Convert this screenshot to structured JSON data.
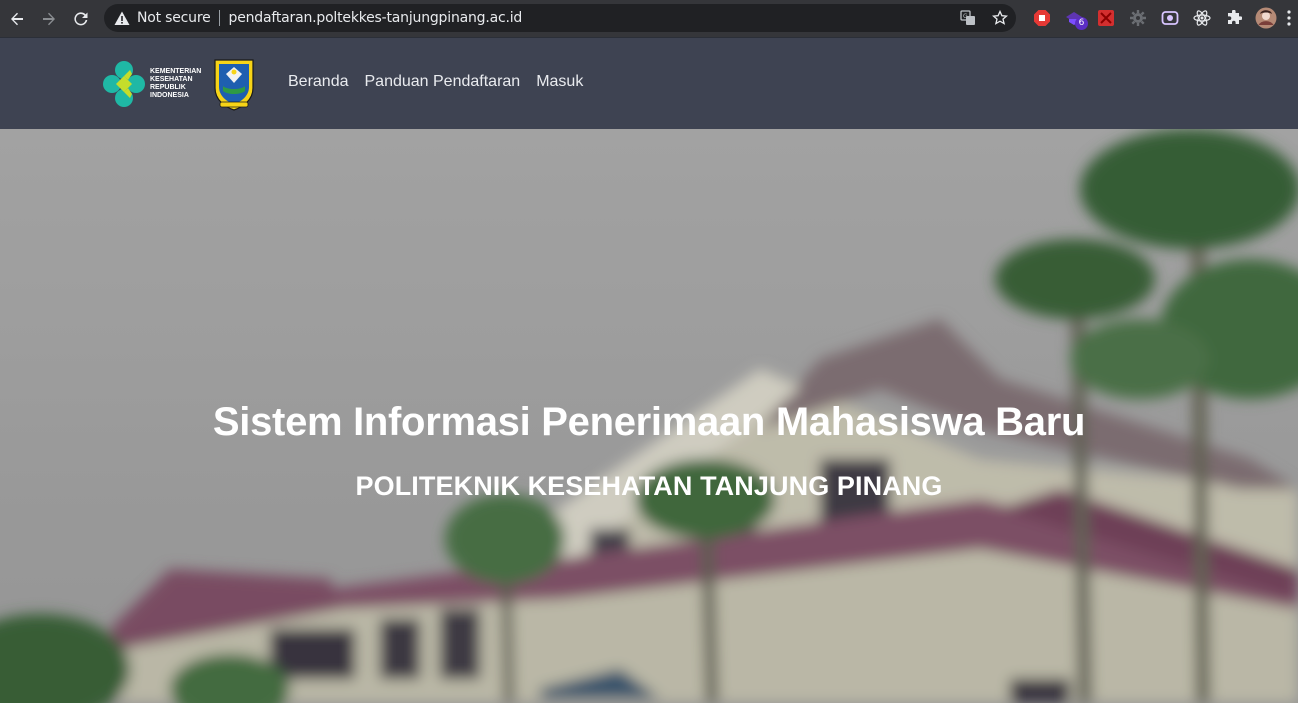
{
  "browser": {
    "security_label": "Not secure",
    "url": "pendaftaran.poltekkes-tanjungpinang.ac.id",
    "extension_badge": "6",
    "icons": [
      "back-icon",
      "forward-icon",
      "reload-icon",
      "warning-icon",
      "translate-icon",
      "star-icon",
      "extension-icon",
      "menu-icon"
    ]
  },
  "header": {
    "logo_text": [
      "KEMENTERIAN",
      "KESEHATAN",
      "REPUBLIK",
      "INDONESIA"
    ],
    "nav": [
      {
        "label": "Beranda"
      },
      {
        "label": "Panduan Pendaftaran"
      },
      {
        "label": "Masuk"
      }
    ]
  },
  "hero": {
    "title": "Sistem Informasi Penerimaan Mahasiswa Baru",
    "subtitle": "POLITEKNIK KESEHATAN TANJUNG PINANG"
  },
  "colors": {
    "chrome_bg": "#35363a",
    "omnibox_bg": "#202124",
    "header_bg": "#3e4352",
    "hero_overlay": "#000000"
  }
}
